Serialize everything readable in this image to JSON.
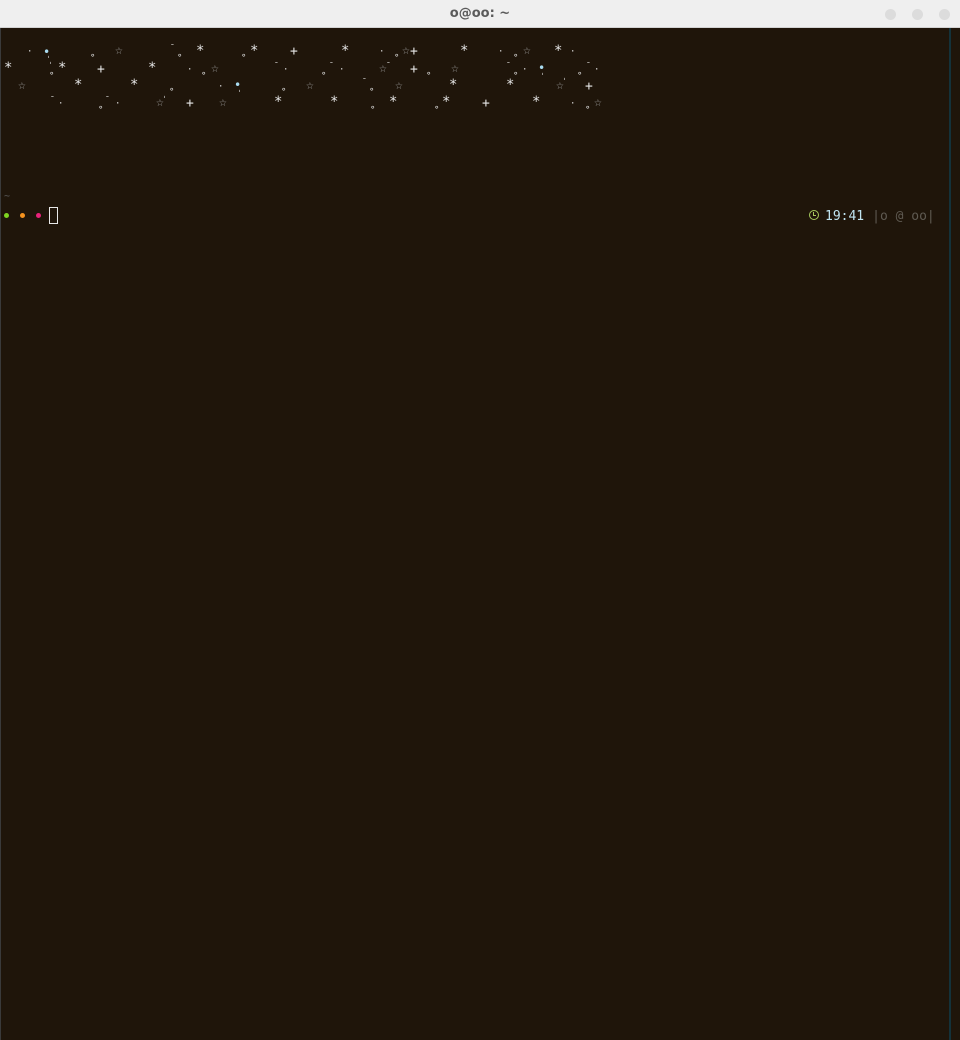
{
  "window": {
    "title": "o@oo: ~"
  },
  "terminal": {
    "starfield_glyphs": [
      "·",
      "•",
      "∘",
      "☆",
      "*",
      "+",
      "ˉ",
      "ˈ"
    ],
    "tilde": "~",
    "prompt": {
      "status_dots": [
        {
          "name": "green",
          "color": "#7ed321"
        },
        {
          "name": "orange",
          "color": "#f5921e"
        },
        {
          "name": "magenta",
          "color": "#e8227a"
        }
      ],
      "cursor": ""
    },
    "right_prompt": {
      "icon": "clock-icon",
      "time": "19:41",
      "user_host": "|o @ oo|"
    }
  },
  "colors": {
    "background": "#1f150a",
    "star_white": "#e6e6e6",
    "star_blue": "#a9dbf0",
    "star_grey": "#a0a0a0"
  }
}
